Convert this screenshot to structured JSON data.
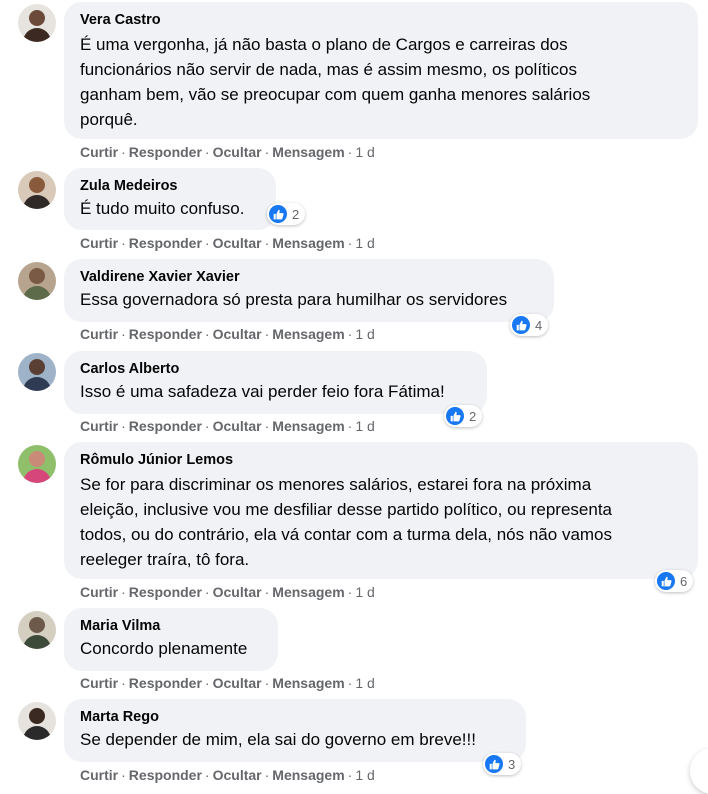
{
  "actions": {
    "like": "Curtir",
    "reply": "Responder",
    "hide": "Ocultar",
    "message": "Mensagem",
    "separator": "·"
  },
  "comments": [
    {
      "author": "Vera Castro",
      "text": "É uma vergonha, já não basta o plano de Cargos e carreiras dos\nfuncionários não servir de nada, mas é assim mesmo, os políticos\nganham bem, vão se preocupar com quem ganha menores salários\nporquê.",
      "time": "1 d",
      "reactions": null
    },
    {
      "author": "Zula Medeiros",
      "text": "É tudo muito confuso.",
      "time": "1 d",
      "reactions": "2"
    },
    {
      "author": "Valdirene Xavier Xavier",
      "text": "Essa governadora só presta para humilhar os servidores",
      "time": "1 d",
      "reactions": "4"
    },
    {
      "author": "Carlos Alberto",
      "text": "Isso é uma safadeza vai perder feio fora Fátima!",
      "time": "1 d",
      "reactions": "2"
    },
    {
      "author": "Rômulo Júnior Lemos",
      "text": "Se for para discriminar os menores salários, estarei fora na próxima\neleição, inclusive vou me desfiliar desse partido político, ou representa\ntodos, ou do contrário, ela vá contar com a turma dela, nós não vamos\nreeleger traíra, tô fora.",
      "time": "1 d",
      "reactions": "6"
    },
    {
      "author": "Maria Vilma",
      "text": "Concordo plenamente",
      "time": "1 d",
      "reactions": null
    },
    {
      "author": "Marta Rego",
      "text": "Se depender de mim, ela sai do governo em breve!!!",
      "time": "1 d",
      "reactions": "3"
    }
  ],
  "colors": {
    "bubble": "#f0f2f5",
    "meta_text": "#65676b",
    "like_blue": "#1877f2"
  },
  "icons": {
    "reaction": "like-thumbs-up-icon"
  }
}
